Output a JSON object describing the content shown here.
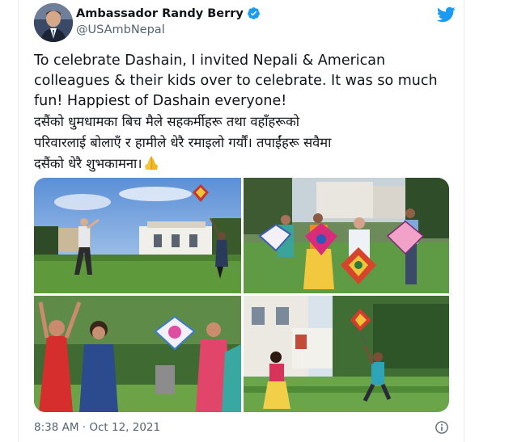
{
  "author": {
    "name": "Ambassador Randy Berry",
    "handle": "@USAmbNepal"
  },
  "tweet": {
    "text_en": "To celebrate Dashain, I invited Nepali & American\ncolleagues & their kids over to celebrate. It was so much\nfun! Happiest of Dashain everyone!",
    "text_ne": "दसैंको धुमधामका बिच मैले सहकर्मीहरू तथा वहाँहरूको\nपरिवारलाई बोलाएँ र हामीले धेरै रमाइलो गर्यौं। तपाईंहरू सवैमा\nदसैंको धेरै शुभकामना।",
    "timestamp": "8:38 AM · Oct 12, 2021"
  },
  "icons": {
    "verified": "verified-badge-icon",
    "platform": "twitter-bird-icon",
    "emoji": "folded-hands-icon",
    "info": "info-icon"
  },
  "colors": {
    "brand": "#1d9bf0",
    "text": "#0f1419",
    "muted": "#536471"
  }
}
